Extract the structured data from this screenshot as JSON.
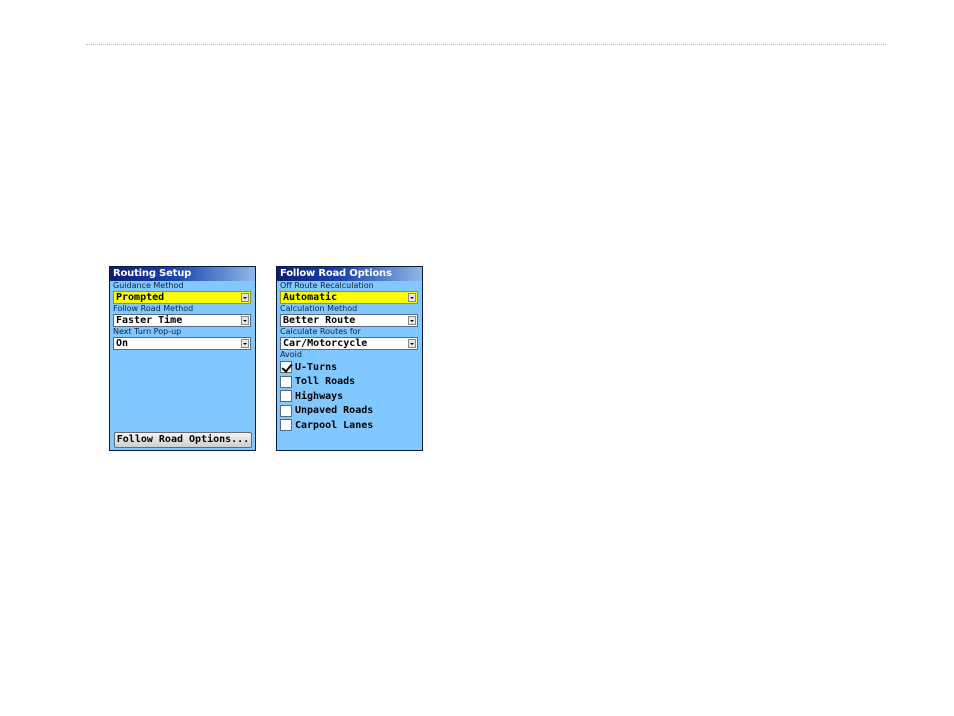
{
  "routing_setup": {
    "title": "Routing Setup",
    "guidance_method": {
      "label": "Guidance Method",
      "value": "Prompted"
    },
    "follow_road_method": {
      "label": "Follow Road Method",
      "value": "Faster Time"
    },
    "next_turn_popup": {
      "label": "Next Turn Pop-up",
      "value": "On"
    },
    "button_label": "Follow Road Options..."
  },
  "follow_road_options": {
    "title": "Follow Road Options",
    "off_route_recalc": {
      "label": "Off Route Recalculation",
      "value": "Automatic"
    },
    "calculation_method": {
      "label": "Calculation Method",
      "value": "Better Route"
    },
    "calculate_routes_for": {
      "label": "Calculate Routes for",
      "value": "Car/Motorcycle"
    },
    "avoid_label": "Avoid",
    "avoid_items": [
      {
        "label": "U-Turns",
        "checked": true
      },
      {
        "label": "Toll Roads",
        "checked": false
      },
      {
        "label": "Highways",
        "checked": false
      },
      {
        "label": "Unpaved Roads",
        "checked": false
      },
      {
        "label": "Carpool Lanes",
        "checked": false
      }
    ]
  },
  "colors": {
    "screen_bg": "#80c8ff",
    "title_bar": "#0a1e7a",
    "highlight": "#ffff00"
  }
}
